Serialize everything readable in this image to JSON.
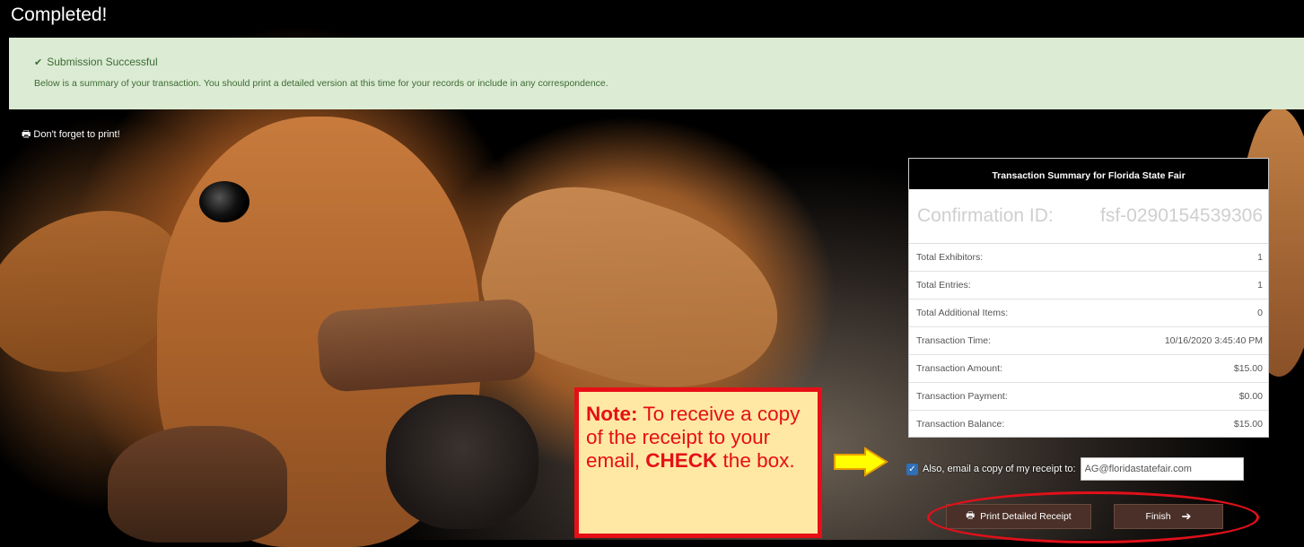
{
  "page": {
    "title": "Completed!"
  },
  "alert": {
    "heading": "Submission Successful",
    "body": "Below is a summary of your transaction. You should print a detailed version at this time for your records or include in any correspondence."
  },
  "print_reminder": "Don't forget to print!",
  "summary": {
    "header": "Transaction Summary for Florida State Fair",
    "confirmation_label": "Confirmation ID:",
    "confirmation_value": "fsf-0290154539306",
    "rows": [
      {
        "label": "Total Exhibitors:",
        "value": "1"
      },
      {
        "label": "Total Entries:",
        "value": "1"
      },
      {
        "label": "Total Additional Items:",
        "value": "0"
      },
      {
        "label": "Transaction Time:",
        "value": "10/16/2020 3:45:40 PM"
      },
      {
        "label": "Transaction Amount:",
        "value": "$15.00"
      },
      {
        "label": "Transaction Payment:",
        "value": "$0.00"
      },
      {
        "label": "Transaction Balance:",
        "value": "$15.00"
      }
    ]
  },
  "email": {
    "label": "Also, email a copy of my receipt to:",
    "value": "AG@floridastatefair.com",
    "checked": true
  },
  "buttons": {
    "print": "Print Detailed Receipt",
    "finish": "Finish"
  },
  "note": {
    "lead": "Note:",
    "text1": " To receive a copy of the receipt to your email, ",
    "emphasis": "CHECK",
    "text2": " the box."
  },
  "colors": {
    "alert_bg": "#dcebd3",
    "alert_text": "#3c6b35",
    "callout_red": "#e60f16",
    "callout_bg": "#ffe8a4",
    "arrow_yellow": "#ffff00",
    "button_bg": "#4a3028",
    "checkbox_blue": "#2f6fb5"
  },
  "icons": {
    "success": "check-icon",
    "print": "printer-icon",
    "finish": "arrow-right-icon"
  }
}
